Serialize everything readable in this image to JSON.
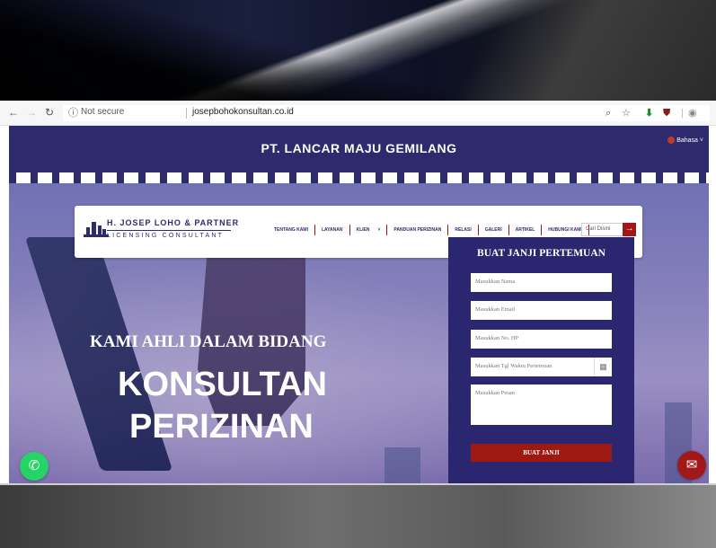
{
  "browser": {
    "security": "Not secure",
    "url": "josepbohokonsultan.co.id"
  },
  "site": {
    "title": "PT. LANCAR MAJU GEMILANG",
    "language": "Bahasa",
    "logo": {
      "name": "H. JOSEP LOHO & PARTNER",
      "subtitle": "LICENSING CONSULTANT"
    },
    "menu": [
      "TENTANG KAMI",
      "LAYANAN",
      "KLIEN",
      "PANDUAN PERIZINAN",
      "RELASI",
      "GALERI",
      "ARTIKEL",
      "HUBUNGI KAMI"
    ],
    "search_placeholder": "Cari Disini",
    "hero": {
      "tagline": "KAMI AHLI DALAM BIDANG",
      "line1": "KONSULTAN",
      "line2": "PERIZINAN"
    },
    "form": {
      "title": "BUAT JANJI PERTEMUAN",
      "name_placeholder": "Masukkan Nama",
      "email_placeholder": "Masukkan Email",
      "phone_placeholder": "Masukkan No. HP",
      "date_placeholder": "Masukkan Tgl Waktu Pertemuan",
      "message_placeholder": "Masukkan Pesan",
      "submit_label": "BUAT JANJI"
    }
  },
  "colors": {
    "brand_navy": "#2d2a6e",
    "accent_red": "#a01818",
    "whatsapp_green": "#25d366"
  }
}
